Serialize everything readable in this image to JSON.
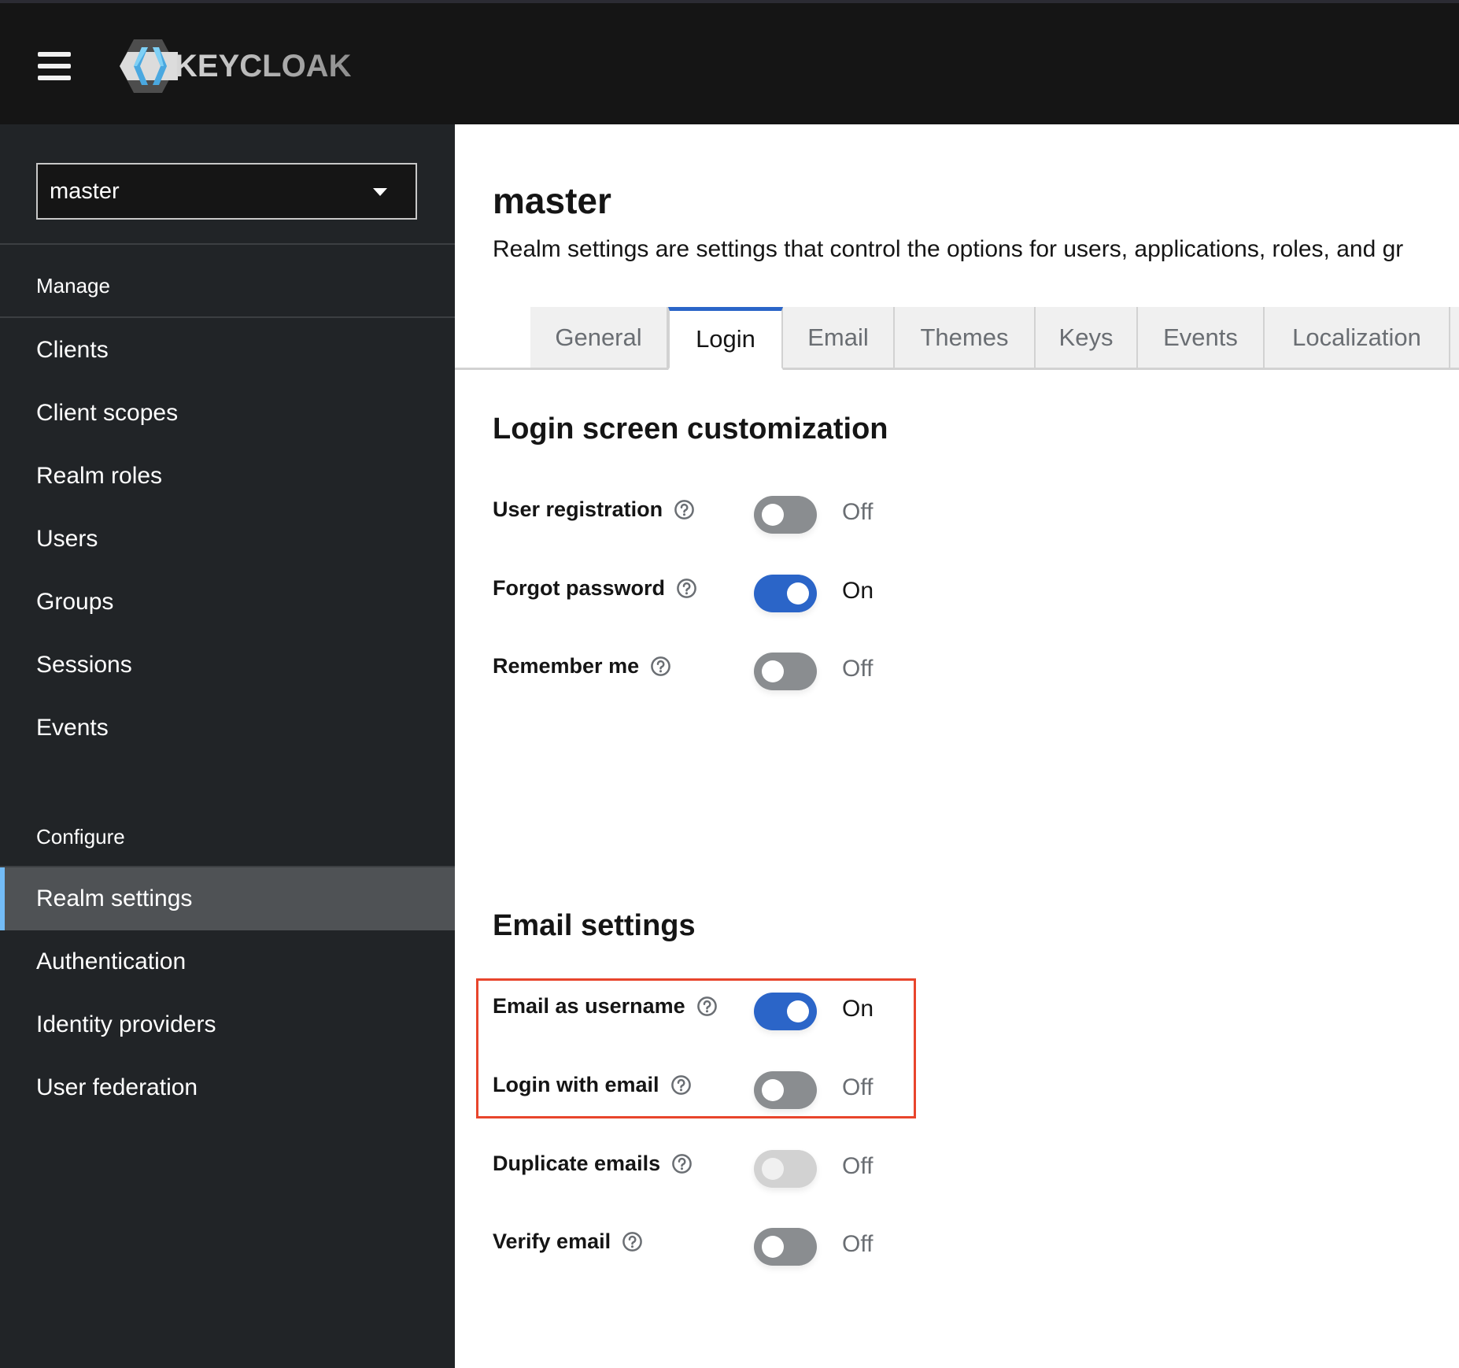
{
  "header": {
    "menu_icon": "hamburger-menu-icon",
    "logo_text": "KEYCLOAK"
  },
  "sidebar": {
    "realm_selector": {
      "value": "master",
      "icon": "caret-down-icon"
    },
    "groups": [
      {
        "label": "Manage",
        "items": [
          {
            "label": "Clients"
          },
          {
            "label": "Client scopes"
          },
          {
            "label": "Realm roles"
          },
          {
            "label": "Users"
          },
          {
            "label": "Groups"
          },
          {
            "label": "Sessions"
          },
          {
            "label": "Events"
          }
        ]
      },
      {
        "label": "Configure",
        "items": [
          {
            "label": "Realm settings",
            "active": true
          },
          {
            "label": "Authentication"
          },
          {
            "label": "Identity providers"
          },
          {
            "label": "User federation"
          }
        ]
      }
    ],
    "accent_color": "#73bcf7"
  },
  "main": {
    "title": "master",
    "description": "Realm settings are settings that control the options for users, applications, roles, and gr",
    "tabs": [
      {
        "label": "General"
      },
      {
        "label": "Login",
        "active": true
      },
      {
        "label": "Email"
      },
      {
        "label": "Themes"
      },
      {
        "label": "Keys"
      },
      {
        "label": "Events"
      },
      {
        "label": "Localization"
      }
    ],
    "sections": [
      {
        "title": "Login screen customization",
        "settings": [
          {
            "label": "User registration",
            "state": "Off",
            "enabled": false
          },
          {
            "label": "Forgot password",
            "state": "On",
            "enabled": true
          },
          {
            "label": "Remember me",
            "state": "Off",
            "enabled": false
          }
        ]
      },
      {
        "title": "Email settings",
        "settings": [
          {
            "label": "Email as username",
            "state": "On",
            "enabled": true,
            "highlighted": true
          },
          {
            "label": "Login with email",
            "state": "Off",
            "enabled": false,
            "highlighted": true
          },
          {
            "label": "Duplicate emails",
            "state": "Off",
            "enabled": false,
            "disabled": true
          },
          {
            "label": "Verify email",
            "state": "Off",
            "enabled": false
          }
        ]
      }
    ],
    "colors": {
      "toggle_on": "#2b65c8",
      "toggle_off": "#8a8d90",
      "toggle_disabled": "#d2d2d2",
      "highlight_box": "#e8452c"
    }
  }
}
